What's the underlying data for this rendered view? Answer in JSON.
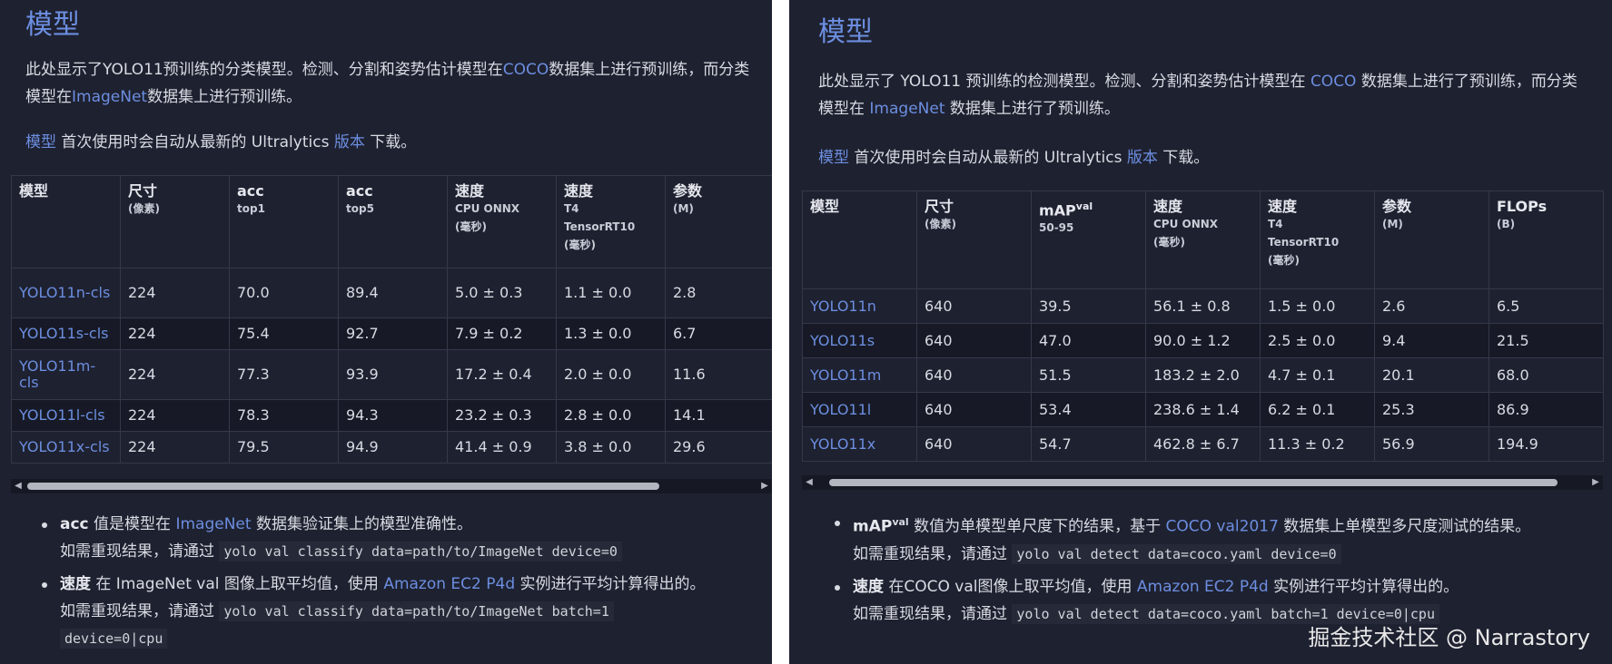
{
  "left": {
    "title": "模型",
    "intro_a": "此处显示了YOLO11预训练的分类模型。检测、分割和姿势估计模型在",
    "intro_link1": "COCO",
    "intro_b": "数据集上进行预训练，而分类模型在",
    "intro_link2": "ImageNet",
    "intro_c": "数据集上进行预训练。",
    "dl_link1": "模型",
    "dl_text": " 首次使用时会自动从最新的 Ultralytics ",
    "dl_link2": "版本",
    "dl_end": " 下载。",
    "headers": [
      {
        "main": "模型",
        "sub": ""
      },
      {
        "main": "尺寸",
        "sub": "(像素)"
      },
      {
        "main": "acc",
        "sub": "top1"
      },
      {
        "main": "acc",
        "sub": "top5"
      },
      {
        "main": "速度",
        "sub": "CPU ONNX",
        "sub2": "(毫秒)"
      },
      {
        "main": "速度",
        "sub": "T4",
        "sub2": "TensorRT10",
        "sub3": "(毫秒)"
      },
      {
        "main": "参数",
        "sub": "(M)"
      }
    ],
    "rows": [
      [
        "YOLO11n-cls",
        "224",
        "70.0",
        "89.4",
        "5.0 ± 0.3",
        "1.1 ± 0.0",
        "2.8"
      ],
      [
        "YOLO11s-cls",
        "224",
        "75.4",
        "92.7",
        "7.9 ± 0.2",
        "1.3 ± 0.0",
        "6.7"
      ],
      [
        "YOLO11m-cls",
        "224",
        "77.3",
        "93.9",
        "17.2 ± 0.4",
        "2.0 ± 0.0",
        "11.6"
      ],
      [
        "YOLO11l-cls",
        "224",
        "78.3",
        "94.3",
        "23.2 ± 0.3",
        "2.8 ± 0.0",
        "14.1"
      ],
      [
        "YOLO11x-cls",
        "224",
        "79.5",
        "94.9",
        "41.4 ± 0.9",
        "3.8 ± 0.0",
        "29.6"
      ]
    ],
    "note1_bold": "acc",
    "note1_a": " 值是模型在 ",
    "note1_link": "ImageNet",
    "note1_b": " 数据集验证集上的模型准确性。",
    "note1_c": "如需重现结果，请通过 ",
    "note1_code": "yolo val classify data=path/to/ImageNet device=0",
    "note2_bold": "速度",
    "note2_a": " 在 ImageNet val 图像上取平均值，使用 ",
    "note2_link": "Amazon EC2 P4d",
    "note2_b": " 实例进行平均计算得出的。",
    "note2_c": "如需重现结果，请通过 ",
    "note2_code1": "yolo val classify data=path/to/ImageNet batch=1",
    "note2_code2": "device=0|cpu"
  },
  "right": {
    "title": "模型",
    "intro_a": "此处显示了 YOLO11 预训练的检测模型。检测、分割和姿势估计模型在 ",
    "intro_link1": "COCO",
    "intro_b": " 数据集上进行了预训练，而分类模型在 ",
    "intro_link2": "ImageNet",
    "intro_c": " 数据集上进行了预训练。",
    "dl_link1": "模型",
    "dl_text": " 首次使用时会自动从最新的 Ultralytics ",
    "dl_link2": "版本",
    "dl_end": " 下载。",
    "headers": [
      {
        "main": "模型",
        "sub": ""
      },
      {
        "main": "尺寸",
        "sub": "(像素)"
      },
      {
        "main": "mAP",
        "sup": "val",
        "sub": "50-95"
      },
      {
        "main": "速度",
        "sub": "CPU ONNX",
        "sub2": "(毫秒)"
      },
      {
        "main": "速度",
        "sub": "T4",
        "sub2": "TensorRT10",
        "sub3": "(毫秒)"
      },
      {
        "main": "参数",
        "sub": "(M)"
      },
      {
        "main": "FLOPs",
        "sub": "(B)"
      }
    ],
    "rows": [
      [
        "YOLO11n",
        "640",
        "39.5",
        "56.1 ± 0.8",
        "1.5 ± 0.0",
        "2.6",
        "6.5"
      ],
      [
        "YOLO11s",
        "640",
        "47.0",
        "90.0 ± 1.2",
        "2.5 ± 0.0",
        "9.4",
        "21.5"
      ],
      [
        "YOLO11m",
        "640",
        "51.5",
        "183.2 ± 2.0",
        "4.7 ± 0.1",
        "20.1",
        "68.0"
      ],
      [
        "YOLO11l",
        "640",
        "53.4",
        "238.6 ± 1.4",
        "6.2 ± 0.1",
        "25.3",
        "86.9"
      ],
      [
        "YOLO11x",
        "640",
        "54.7",
        "462.8 ± 6.7",
        "11.3 ± 0.2",
        "56.9",
        "194.9"
      ]
    ],
    "note1_bold": "mAP",
    "note1_sup": "val",
    "note1_a": " 数值为单模型单尺度下的结果，基于 ",
    "note1_link": "COCO val2017",
    "note1_b": " 数据集上单模型多尺度测试的结果。",
    "note1_c": "如需重现结果，请通过 ",
    "note1_code": "yolo val detect data=coco.yaml device=0",
    "note2_bold": "速度",
    "note2_a": " 在COCO val图像上取平均值，使用 ",
    "note2_link": "Amazon EC2 P4d",
    "note2_b": " 实例进行平均计算得出的。",
    "note2_c": "如需重现结果，请通过 ",
    "note2_code": "yolo val detect data=coco.yaml batch=1 device=0|cpu"
  },
  "watermark": "掘金技术社区 @ Narrastory"
}
